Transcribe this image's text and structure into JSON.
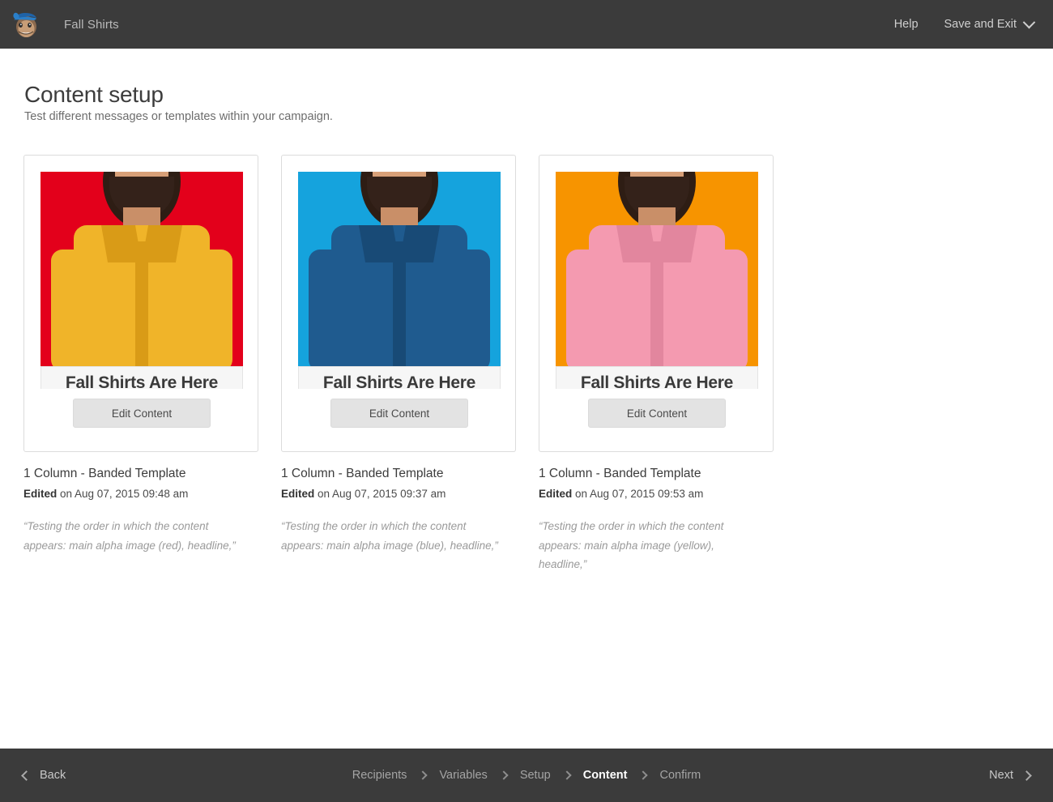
{
  "header": {
    "logo_icon": "mailchimp-freddie-logo",
    "campaign_title": "Fall Shirts",
    "help_label": "Help",
    "save_exit_label": "Save and Exit",
    "save_exit_caret_icon": "chevron-down-icon",
    "bar_color": "#3b3b3b"
  },
  "main": {
    "title": "Content setup",
    "subtitle": "Test different messages or templates within your campaign.",
    "cards": [
      {
        "edit_button_label": "Edit Content",
        "banner_headline": "Fall Shirts Are Here",
        "template_name": "1 Column - Banded Template",
        "edited_label": "Edited",
        "edited_date": " on Aug 07, 2015 09:48 am",
        "quote": "“Testing the order in which the content appears: main alpha image (red), headline,”",
        "bg_color": "#e3001b",
        "shirt_color": "#f0b429",
        "shirt_shadow": "#d99b17"
      },
      {
        "edit_button_label": "Edit Content",
        "banner_headline": "Fall Shirts Are Here",
        "template_name": "1 Column - Banded Template",
        "edited_label": "Edited",
        "edited_date": " on Aug 07, 2015 09:37 am",
        "quote": "“Testing the order in which the content appears: main alpha image (blue), headline,”",
        "bg_color": "#15a3dd",
        "shirt_color": "#1f5b8f",
        "shirt_shadow": "#184a76"
      },
      {
        "edit_button_label": "Edit Content",
        "banner_headline": "Fall Shirts Are Here",
        "template_name": "1 Column - Banded Template",
        "edited_label": "Edited",
        "edited_date": " on Aug 07, 2015 09:53 am",
        "quote": "“Testing the order in which the content appears: main alpha image (yellow), headline,”",
        "bg_color": "#f79400",
        "shirt_color": "#f49ab0",
        "shirt_shadow": "#e2869e"
      }
    ]
  },
  "footer": {
    "back_label": "Back",
    "back_icon": "chevron-left-icon",
    "next_label": "Next",
    "next_icon": "chevron-right-icon",
    "steps": [
      {
        "label": "Recipients",
        "active": false
      },
      {
        "label": "Variables",
        "active": false
      },
      {
        "label": "Setup",
        "active": false
      },
      {
        "label": "Content",
        "active": true
      },
      {
        "label": "Confirm",
        "active": false
      }
    ],
    "bar_color": "#3b3b3b"
  }
}
